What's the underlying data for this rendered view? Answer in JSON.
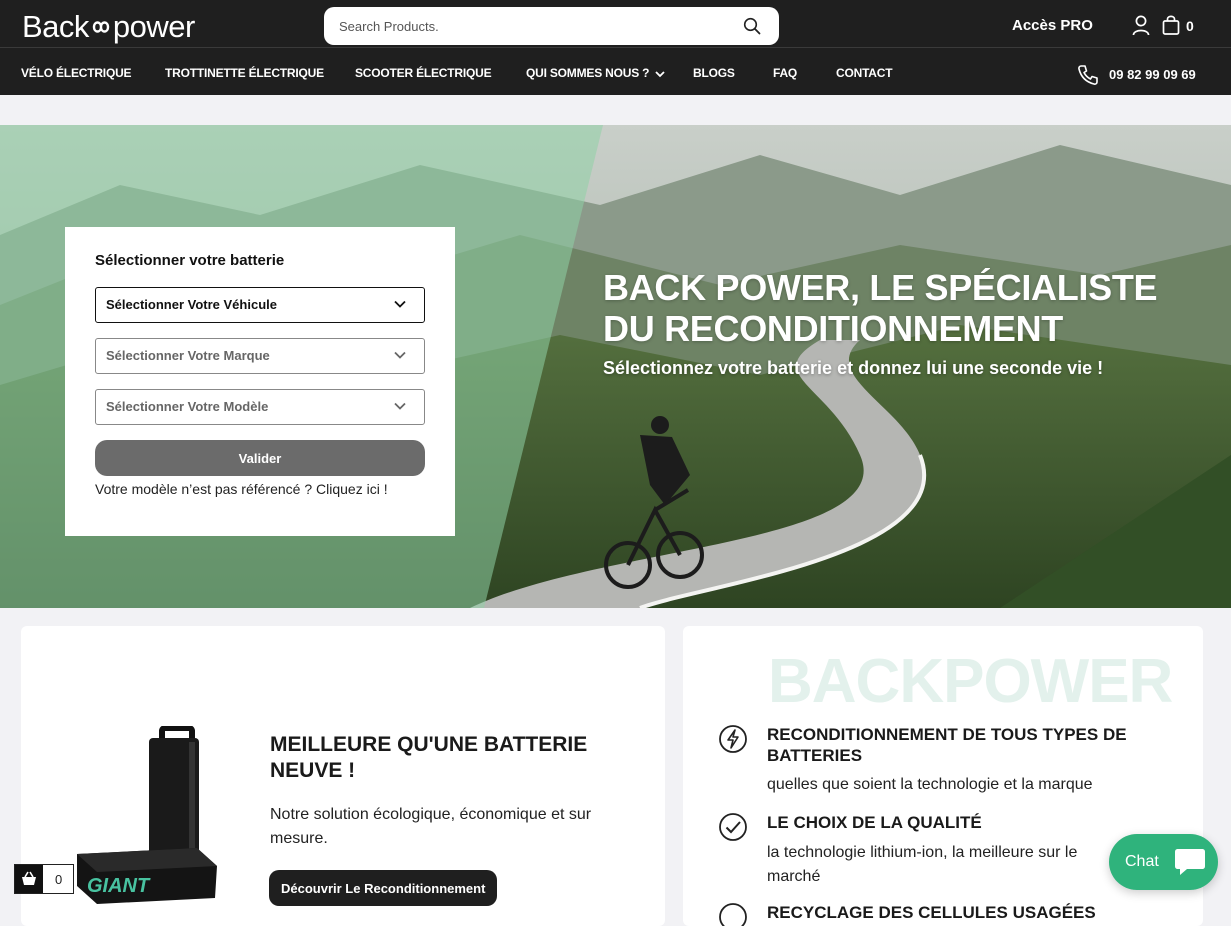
{
  "header": {
    "logo": "Back",
    "logo_tail": "power",
    "search": {
      "placeholder": "Search Products."
    },
    "pro_label": "Accès PRO",
    "cart_count": "0",
    "phone": "09 82 99 09 69"
  },
  "nav": {
    "items": [
      {
        "label": "VÉLO ÉLECTRIQUE"
      },
      {
        "label": "TROTTINETTE ÉLECTRIQUE"
      },
      {
        "label": "SCOOTER ÉLECTRIQUE"
      },
      {
        "label": "QUI SOMMES NOUS ?"
      },
      {
        "label": "BLOGS"
      },
      {
        "label": "FAQ"
      },
      {
        "label": "CONTACT"
      }
    ]
  },
  "hero": {
    "selector_title": "Sélectionner votre batterie",
    "vehicle": "Sélectionner Votre Véhicule",
    "brand": "Sélectionner Votre Marque",
    "model": "Sélectionner Votre Modèle",
    "validate": "Valider",
    "not_found": "Votre modèle n’est pas référencé ? Cliquez ici !",
    "title_line1": "BACK POWER, LE SPÉCIALISTE",
    "title_line2": "DU RECONDITIONNEMENT",
    "subtitle": "Sélectionnez votre batterie et donnez lui une seconde vie !"
  },
  "card_left": {
    "title": "MEILLEURE QU'UNE BATTERIE NEUVE !",
    "text": "Notre solution écologique, économique et sur mesure.",
    "button": "Découvrir Le Reconditionnement",
    "battery_brand": "GIANT"
  },
  "card_right": {
    "watermark": "BACKPOWER",
    "features": [
      {
        "icon": "lightning-icon",
        "title": "RECONDITIONNEMENT DE TOUS TYPES DE BATTERIES",
        "text": "quelles que soient la technologie et la marque"
      },
      {
        "icon": "check-circle-icon",
        "title": "LE CHOIX DE LA QUALITÉ",
        "text": "la technologie lithium-ion, la meilleure sur le marché"
      },
      {
        "icon": "recycle-icon",
        "title": "RECYCLAGE DES CELLULES USAGÉES",
        "text": ""
      }
    ]
  },
  "floating": {
    "basket_count": "0",
    "chat_label": "Chat"
  },
  "colors": {
    "header_bg": "#1f1f1f",
    "accent_green": "#2fb37c",
    "button_grey": "#6b6b6b",
    "hero_overlay": "#8fd1a6"
  }
}
